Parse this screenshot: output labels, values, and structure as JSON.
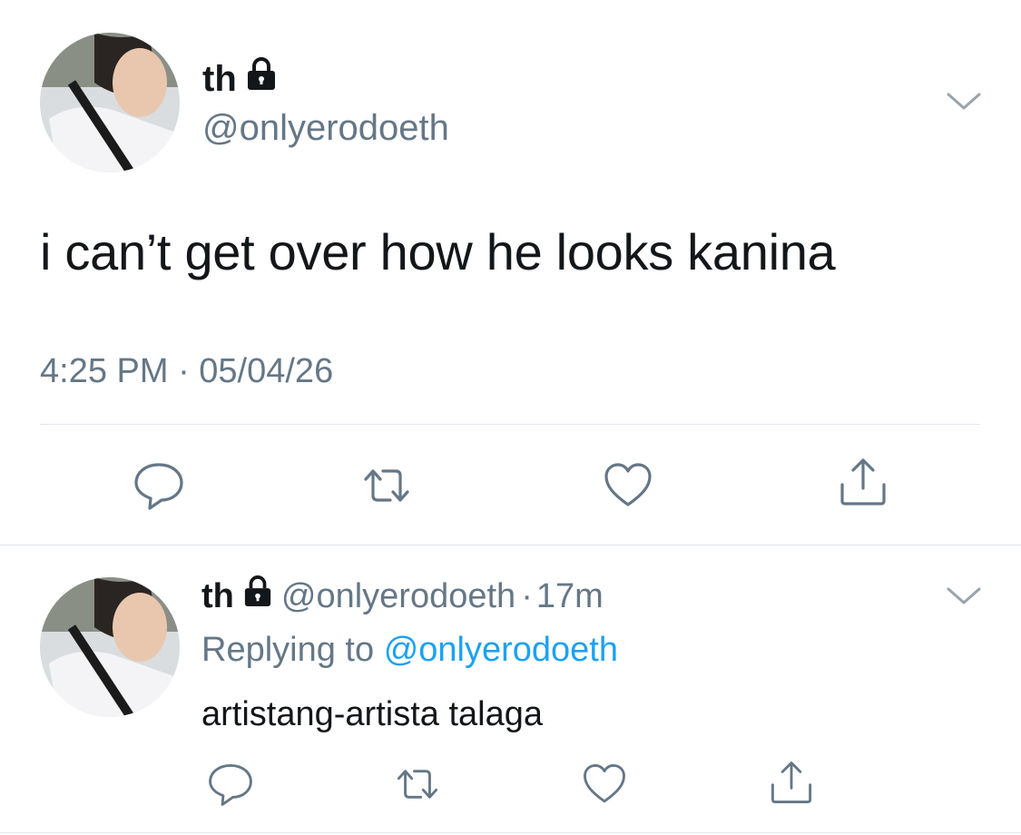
{
  "main_tweet": {
    "display_name": "th",
    "handle": "@onlyerodoeth",
    "text": "i can’t get over how he looks kanina",
    "timestamp": "4:25 PM · 05/04/26",
    "account_locked_icon": "lock-icon",
    "actions": [
      "reply-icon",
      "retweet-icon",
      "like-icon",
      "share-icon"
    ]
  },
  "reply_tweet": {
    "display_name": "th",
    "handle": "@onlyerodoeth",
    "separator": "·",
    "age": "17m",
    "replying_to_label": "Replying to",
    "replying_to_handle": "@onlyerodoeth",
    "text": "artistang-artista talaga",
    "account_locked_icon": "lock-icon",
    "actions": [
      "reply-icon",
      "retweet-icon",
      "like-icon",
      "share-icon"
    ]
  },
  "colors": {
    "text": "#14171a",
    "secondary": "#657786",
    "link": "#1da1f2",
    "divider": "#e1e8ed"
  }
}
